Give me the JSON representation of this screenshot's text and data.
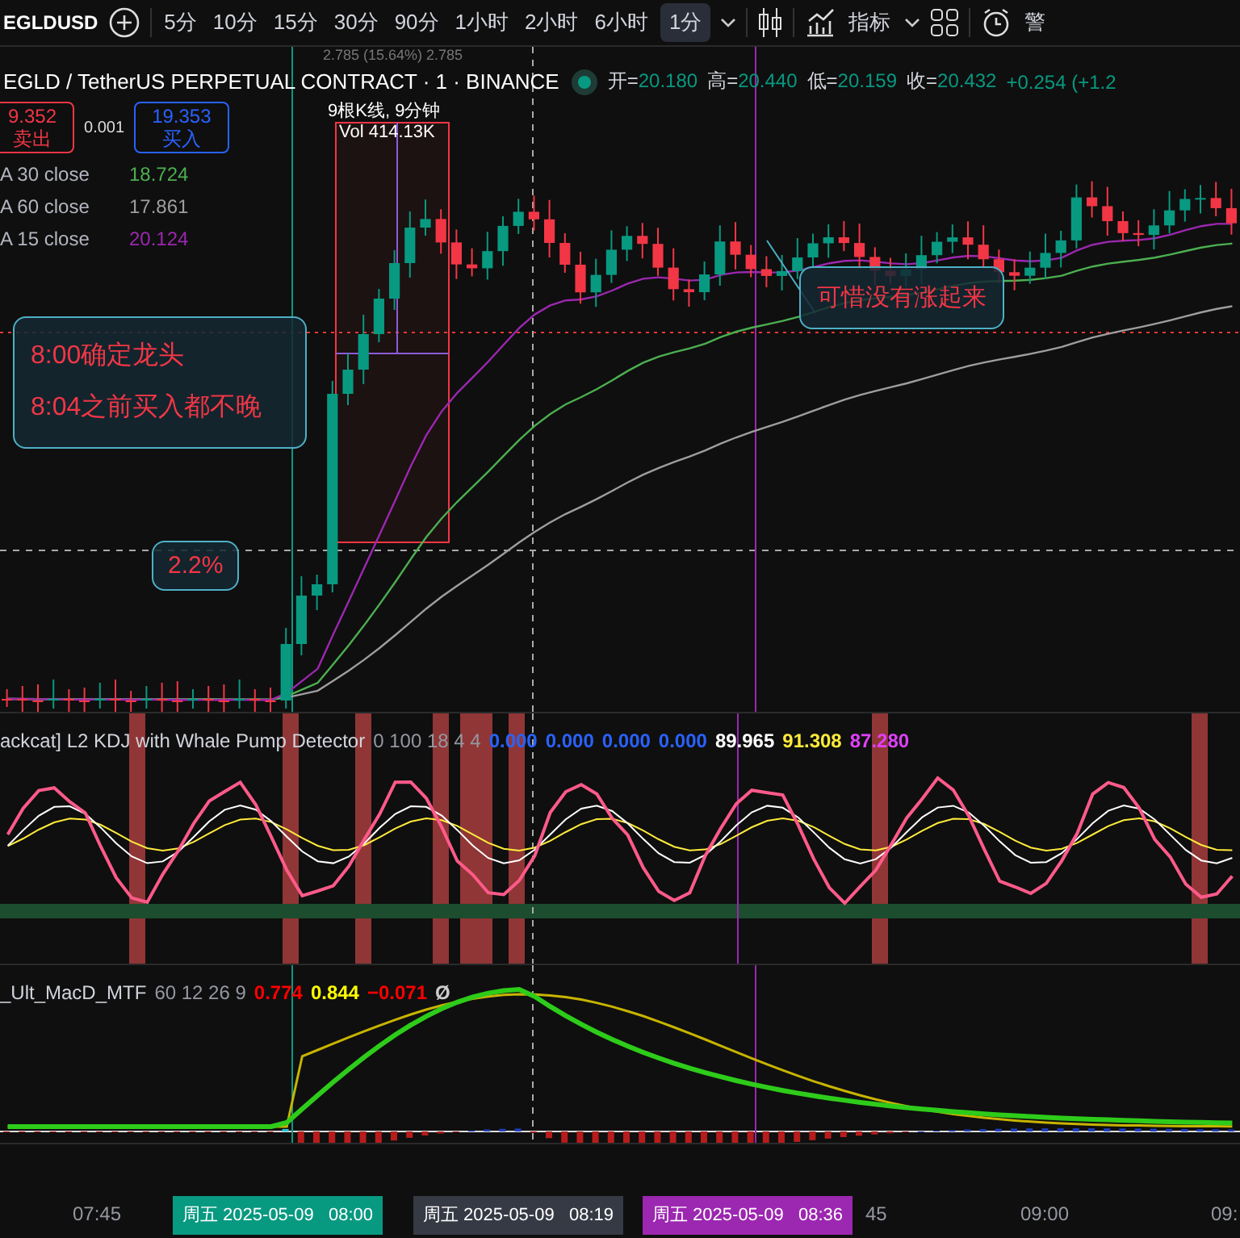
{
  "toolbar": {
    "symbol": "EGLDUSD",
    "intervals": [
      {
        "label": "5分",
        "selected": false
      },
      {
        "label": "10分",
        "selected": false
      },
      {
        "label": "15分",
        "selected": false
      },
      {
        "label": "30分",
        "selected": false
      },
      {
        "label": "90分",
        "selected": false
      },
      {
        "label": "1小时",
        "selected": false
      },
      {
        "label": "2小时",
        "selected": false
      },
      {
        "label": "6小时",
        "selected": false
      },
      {
        "label": "1分",
        "selected": true
      }
    ],
    "indicators_label": "指标",
    "alerts_label": "警"
  },
  "legend": {
    "title": "EGLD / TetherUS PERPETUAL CONTRACT · 1 · BINANCE",
    "ohlc": [
      {
        "label": "开=",
        "value": "20.180"
      },
      {
        "label": "高=",
        "value": "20.440"
      },
      {
        "label": "低=",
        "value": "20.159"
      },
      {
        "label": "收=",
        "value": "20.432"
      }
    ],
    "change": "+0.254 (+1.2"
  },
  "trade": {
    "sell_price": "9.352",
    "sell_label": "卖出",
    "spread": "0.001",
    "buy_price": "19.353",
    "buy_label": "买入"
  },
  "ma_lines": [
    {
      "label": "A 30 close",
      "value": "18.724",
      "color": "#4caf50"
    },
    {
      "label": "A 60 close",
      "value": "17.861",
      "color": "#9e9e9e"
    },
    {
      "label": "A 15 close",
      "value": "20.124",
      "color": "#9c27b0"
    }
  ],
  "measure": {
    "range": "2.785 (15.64%) 2.785",
    "bars": "9根K线, 9分钟",
    "volume": "Vol 414.13K"
  },
  "annotations": [
    {
      "kind": "big",
      "text": "8:00确定龙头\n8:04之前买入都不晚"
    },
    {
      "kind": "small",
      "text": "2.2%"
    },
    {
      "kind": "small",
      "text": "可惜没有涨起来"
    }
  ],
  "kdj": {
    "title": "ackcat] L2 KDJ with Whale Pump Detector",
    "params": "0 100 18 4 4",
    "values": [
      {
        "text": "0.000",
        "color": "#2962ff"
      },
      {
        "text": "0.000",
        "color": "#2962ff"
      },
      {
        "text": "0.000",
        "color": "#2962ff"
      },
      {
        "text": "0.000",
        "color": "#2962ff"
      },
      {
        "text": "89.965",
        "color": "#ffffff"
      },
      {
        "text": "91.308",
        "color": "#ffeb3b"
      },
      {
        "text": "87.280",
        "color": "#e040fb"
      }
    ]
  },
  "macd": {
    "title": "_Ult_MacD_MTF",
    "params": "60 12 26 9",
    "values": [
      {
        "text": "0.774",
        "color": "#ff0000"
      },
      {
        "text": "0.844",
        "color": "#ffff00"
      },
      {
        "text": "−0.071",
        "color": "#ff0000"
      },
      {
        "text": "Ø",
        "color": "#cccccc"
      }
    ]
  },
  "time_axis": {
    "ticks": [
      "07:45",
      "45",
      "09:00",
      "09:"
    ],
    "cursor_labels": [
      {
        "text": "周五 2025-05-09   08:00",
        "color": "#089981"
      },
      {
        "text": "周五 2025-05-09   08:19",
        "color": "#363a45"
      },
      {
        "text": "周五 2025-05-09   08:36",
        "color": "#9c27b0"
      }
    ]
  }
}
